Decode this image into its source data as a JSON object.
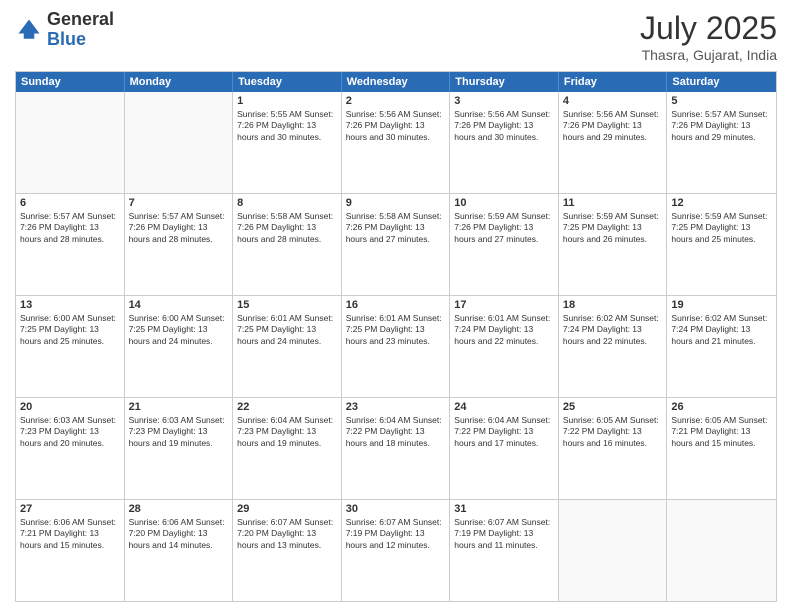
{
  "header": {
    "logo": {
      "line1": "General",
      "line2": "Blue"
    },
    "title": "July 2025",
    "location": "Thasra, Gujarat, India"
  },
  "weekdays": [
    "Sunday",
    "Monday",
    "Tuesday",
    "Wednesday",
    "Thursday",
    "Friday",
    "Saturday"
  ],
  "rows": [
    [
      {
        "day": "",
        "info": ""
      },
      {
        "day": "",
        "info": ""
      },
      {
        "day": "1",
        "info": "Sunrise: 5:55 AM\nSunset: 7:26 PM\nDaylight: 13 hours\nand 30 minutes."
      },
      {
        "day": "2",
        "info": "Sunrise: 5:56 AM\nSunset: 7:26 PM\nDaylight: 13 hours\nand 30 minutes."
      },
      {
        "day": "3",
        "info": "Sunrise: 5:56 AM\nSunset: 7:26 PM\nDaylight: 13 hours\nand 30 minutes."
      },
      {
        "day": "4",
        "info": "Sunrise: 5:56 AM\nSunset: 7:26 PM\nDaylight: 13 hours\nand 29 minutes."
      },
      {
        "day": "5",
        "info": "Sunrise: 5:57 AM\nSunset: 7:26 PM\nDaylight: 13 hours\nand 29 minutes."
      }
    ],
    [
      {
        "day": "6",
        "info": "Sunrise: 5:57 AM\nSunset: 7:26 PM\nDaylight: 13 hours\nand 28 minutes."
      },
      {
        "day": "7",
        "info": "Sunrise: 5:57 AM\nSunset: 7:26 PM\nDaylight: 13 hours\nand 28 minutes."
      },
      {
        "day": "8",
        "info": "Sunrise: 5:58 AM\nSunset: 7:26 PM\nDaylight: 13 hours\nand 28 minutes."
      },
      {
        "day": "9",
        "info": "Sunrise: 5:58 AM\nSunset: 7:26 PM\nDaylight: 13 hours\nand 27 minutes."
      },
      {
        "day": "10",
        "info": "Sunrise: 5:59 AM\nSunset: 7:26 PM\nDaylight: 13 hours\nand 27 minutes."
      },
      {
        "day": "11",
        "info": "Sunrise: 5:59 AM\nSunset: 7:25 PM\nDaylight: 13 hours\nand 26 minutes."
      },
      {
        "day": "12",
        "info": "Sunrise: 5:59 AM\nSunset: 7:25 PM\nDaylight: 13 hours\nand 25 minutes."
      }
    ],
    [
      {
        "day": "13",
        "info": "Sunrise: 6:00 AM\nSunset: 7:25 PM\nDaylight: 13 hours\nand 25 minutes."
      },
      {
        "day": "14",
        "info": "Sunrise: 6:00 AM\nSunset: 7:25 PM\nDaylight: 13 hours\nand 24 minutes."
      },
      {
        "day": "15",
        "info": "Sunrise: 6:01 AM\nSunset: 7:25 PM\nDaylight: 13 hours\nand 24 minutes."
      },
      {
        "day": "16",
        "info": "Sunrise: 6:01 AM\nSunset: 7:25 PM\nDaylight: 13 hours\nand 23 minutes."
      },
      {
        "day": "17",
        "info": "Sunrise: 6:01 AM\nSunset: 7:24 PM\nDaylight: 13 hours\nand 22 minutes."
      },
      {
        "day": "18",
        "info": "Sunrise: 6:02 AM\nSunset: 7:24 PM\nDaylight: 13 hours\nand 22 minutes."
      },
      {
        "day": "19",
        "info": "Sunrise: 6:02 AM\nSunset: 7:24 PM\nDaylight: 13 hours\nand 21 minutes."
      }
    ],
    [
      {
        "day": "20",
        "info": "Sunrise: 6:03 AM\nSunset: 7:23 PM\nDaylight: 13 hours\nand 20 minutes."
      },
      {
        "day": "21",
        "info": "Sunrise: 6:03 AM\nSunset: 7:23 PM\nDaylight: 13 hours\nand 19 minutes."
      },
      {
        "day": "22",
        "info": "Sunrise: 6:04 AM\nSunset: 7:23 PM\nDaylight: 13 hours\nand 19 minutes."
      },
      {
        "day": "23",
        "info": "Sunrise: 6:04 AM\nSunset: 7:22 PM\nDaylight: 13 hours\nand 18 minutes."
      },
      {
        "day": "24",
        "info": "Sunrise: 6:04 AM\nSunset: 7:22 PM\nDaylight: 13 hours\nand 17 minutes."
      },
      {
        "day": "25",
        "info": "Sunrise: 6:05 AM\nSunset: 7:22 PM\nDaylight: 13 hours\nand 16 minutes."
      },
      {
        "day": "26",
        "info": "Sunrise: 6:05 AM\nSunset: 7:21 PM\nDaylight: 13 hours\nand 15 minutes."
      }
    ],
    [
      {
        "day": "27",
        "info": "Sunrise: 6:06 AM\nSunset: 7:21 PM\nDaylight: 13 hours\nand 15 minutes."
      },
      {
        "day": "28",
        "info": "Sunrise: 6:06 AM\nSunset: 7:20 PM\nDaylight: 13 hours\nand 14 minutes."
      },
      {
        "day": "29",
        "info": "Sunrise: 6:07 AM\nSunset: 7:20 PM\nDaylight: 13 hours\nand 13 minutes."
      },
      {
        "day": "30",
        "info": "Sunrise: 6:07 AM\nSunset: 7:19 PM\nDaylight: 13 hours\nand 12 minutes."
      },
      {
        "day": "31",
        "info": "Sunrise: 6:07 AM\nSunset: 7:19 PM\nDaylight: 13 hours\nand 11 minutes."
      },
      {
        "day": "",
        "info": ""
      },
      {
        "day": "",
        "info": ""
      }
    ]
  ]
}
